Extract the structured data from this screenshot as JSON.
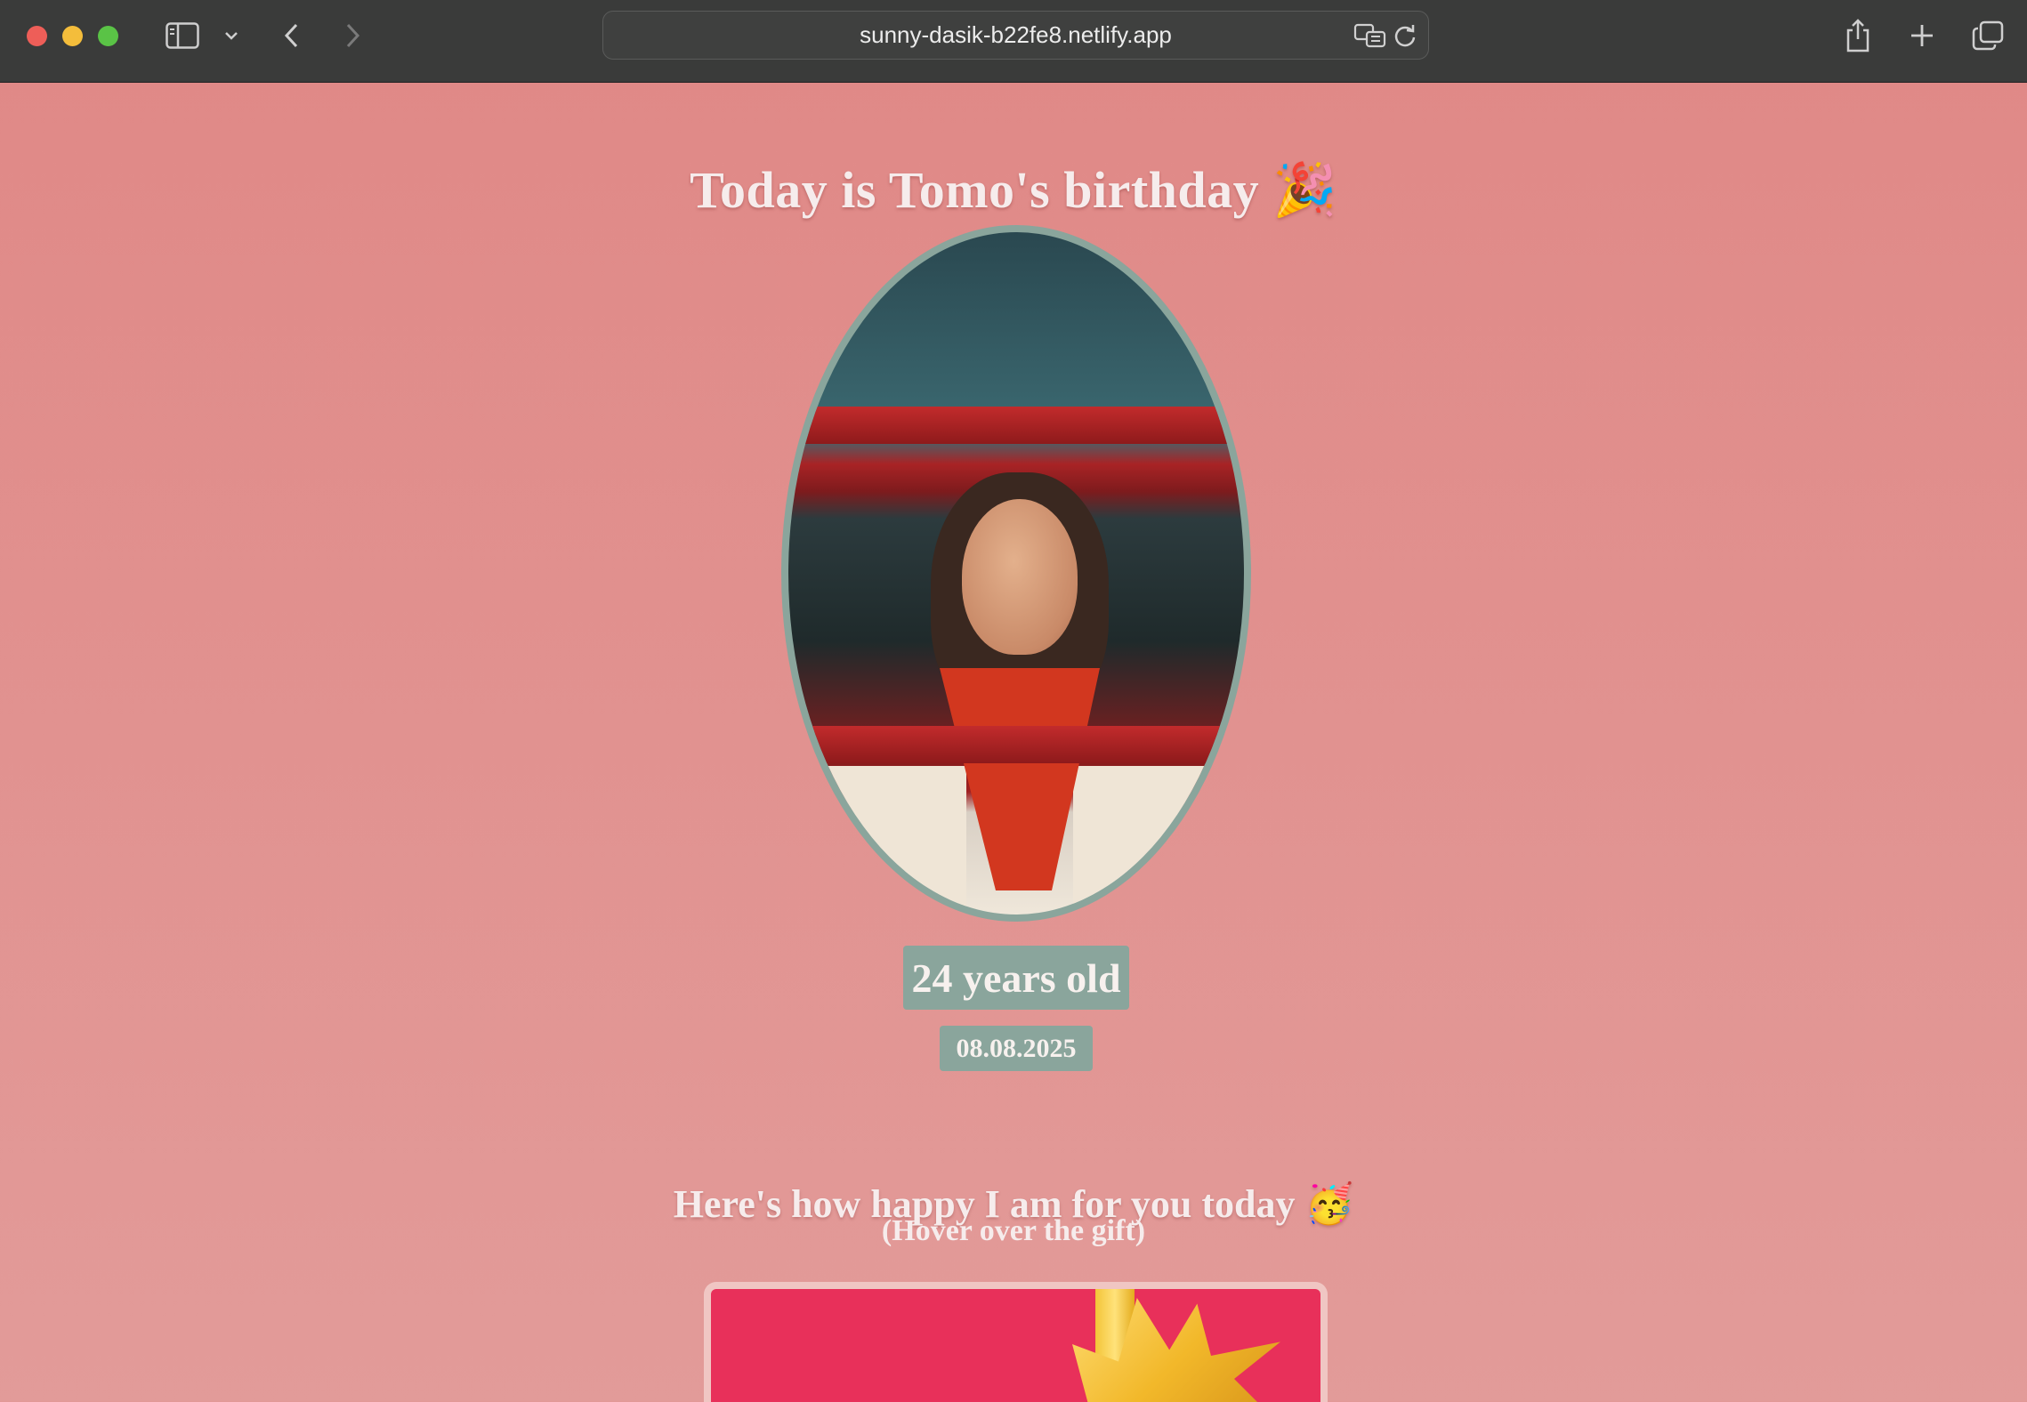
{
  "browser": {
    "url": "sunny-dasik-b22fe8.netlify.app"
  },
  "page": {
    "title": "Today is Tomo's birthday",
    "title_emoji": "🎉",
    "age": "24 years old",
    "date": "08.08.2025",
    "happy_heading": "Here's how happy I am for you today",
    "happy_emoji": "🥳",
    "hover_hint": "(Hover over the gift)"
  },
  "colors": {
    "background": "#e18a88",
    "badge": "#8aa59c",
    "gift_box": "#e8305a",
    "ribbon": "#f3c437"
  }
}
